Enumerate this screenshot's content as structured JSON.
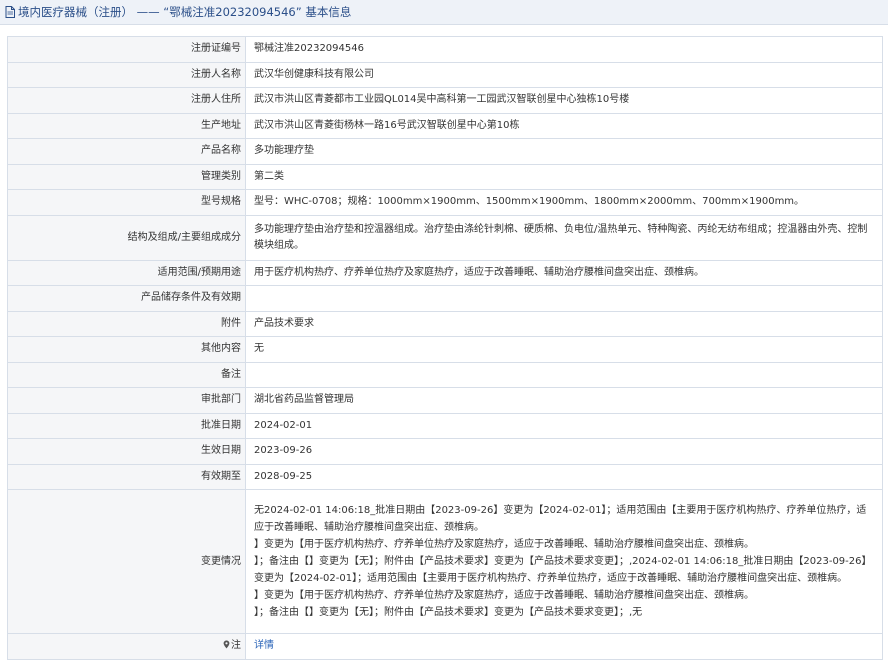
{
  "title": "境内医疗器械（注册） —— “鄂械注准20232094546” 基本信息",
  "rows": [
    {
      "label": "注册证编号",
      "value": "鄂械注准20232094546"
    },
    {
      "label": "注册人名称",
      "value": "武汉华创健康科技有限公司"
    },
    {
      "label": "注册人住所",
      "value": "武汉市洪山区青菱都市工业园QL014吴中高科第一工园武汉智联创星中心独栋10号楼"
    },
    {
      "label": "生产地址",
      "value": "武汉市洪山区青菱街杨林一路16号武汉智联创星中心第10栋"
    },
    {
      "label": "产品名称",
      "value": "多功能理疗垫"
    },
    {
      "label": "管理类别",
      "value": "第二类"
    },
    {
      "label": "型号规格",
      "value": "型号：WHC-0708；规格：1000mm×1900mm、1500mm×1900mm、1800mm×2000mm、700mm×1900mm。"
    },
    {
      "label": "结构及组成/主要组成成分",
      "value": "多功能理疗垫由治疗垫和控温器组成。治疗垫由涤纶针刺棉、硬质棉、负电位/温热单元、特种陶瓷、丙纶无纺布组成；控温器由外壳、控制模块组成。"
    },
    {
      "label": "适用范围/预期用途",
      "value": "用于医疗机构热疗、疗养单位热疗及家庭热疗，适应于改善睡眠、辅助治疗腰椎间盘突出症、颈椎病。"
    },
    {
      "label": "产品储存条件及有效期",
      "value": ""
    },
    {
      "label": "附件",
      "value": "产品技术要求"
    },
    {
      "label": "其他内容",
      "value": "无"
    },
    {
      "label": "备注",
      "value": ""
    },
    {
      "label": "审批部门",
      "value": "湖北省药品监督管理局"
    },
    {
      "label": "批准日期",
      "value": "2024-02-01"
    },
    {
      "label": "生效日期",
      "value": "2023-09-26"
    },
    {
      "label": "有效期至",
      "value": "2028-09-25"
    }
  ],
  "changes": {
    "label": "变更情况",
    "lines": [
      "无2024-02-01 14:06:18_批准日期由【2023-09-26】变更为【2024-02-01】；适用范围由【主要用于医疗机构热疗、疗养单位热疗，适应于改善睡眠、辅助治疗腰椎间盘突出症、颈椎病。",
      "】变更为【用于医疗机构热疗、疗养单位热疗及家庭热疗，适应于改善睡眠、辅助治疗腰椎间盘突出症、颈椎病。",
      "】；备注由【】变更为【无】；附件由【产品技术要求】变更为【产品技术要求变更】；,2024-02-01 14:06:18_批准日期由【2023-09-26】变更为【2024-02-01】；适用范围由【主要用于医疗机构热疗、疗养单位热疗，适应于改善睡眠、辅助治疗腰椎间盘突出症、颈椎病。",
      "】变更为【用于医疗机构热疗、疗养单位热疗及家庭热疗，适应于改善睡眠、辅助治疗腰椎间盘突出症、颈椎病。",
      "】；备注由【】变更为【无】；附件由【产品技术要求】变更为【产品技术要求变更】；,无"
    ]
  },
  "note": {
    "label": "注",
    "link_text": "详情"
  },
  "colors": {
    "title_text": "#2b4f89",
    "link": "#2a64b8",
    "border": "#d7dee8",
    "label_bg": "#f5f6f8"
  },
  "icons": {
    "title": "document-icon",
    "note": "notice-icon"
  }
}
